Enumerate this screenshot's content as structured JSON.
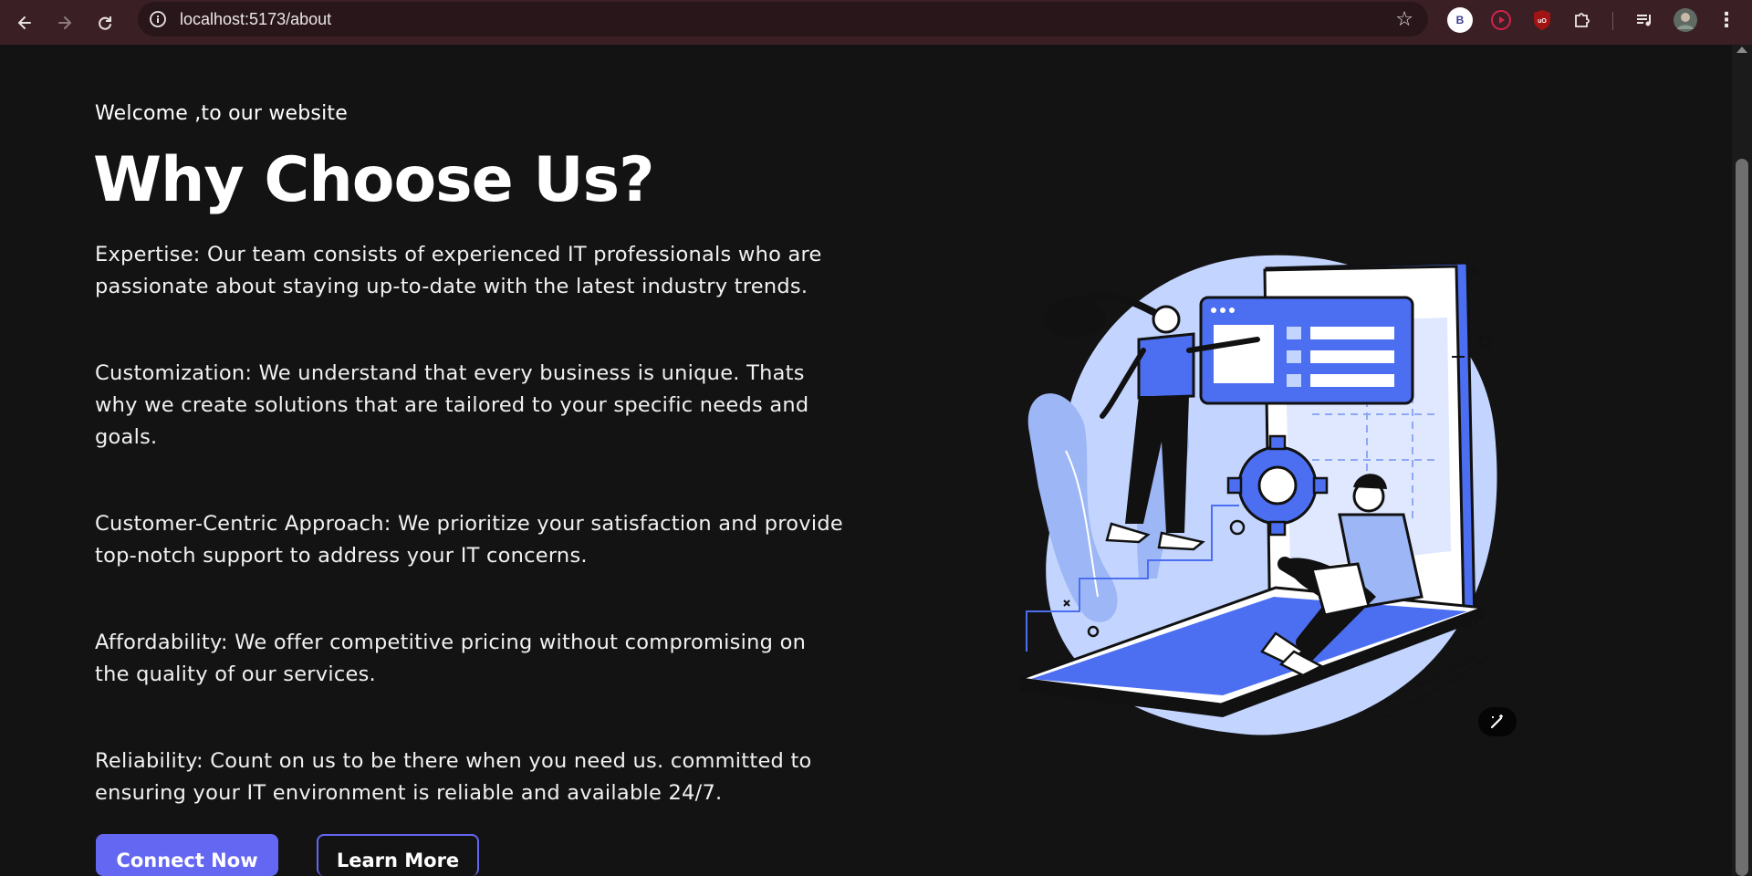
{
  "browser": {
    "url": "localhost:5173/about",
    "back_icon": "arrow-left-icon",
    "forward_icon": "arrow-right-icon",
    "reload_icon": "reload-icon",
    "bookmark_icon": "star-icon",
    "profile_ext_letter": "B",
    "menu_icon": "kebab-menu-icon"
  },
  "hero": {
    "welcome": "Welcome ,to our website",
    "title": "Why Choose Us?",
    "features": [
      "Expertise: Our team consists of experienced IT professionals who are passionate about staying up-to-date with the latest industry trends.",
      "Customization: We understand that every business is unique. Thats why we create solutions that are tailored to your specific needs and goals.",
      "Customer-Centric Approach: We prioritize your satisfaction and provide top-notch support to address your IT concerns.",
      "Affordability: We offer competitive pricing without compromising on the quality of our services.",
      "Reliability: Count on us to be there when you need us. committed to ensuring your IT environment is reliable and available 24/7."
    ],
    "primary_button": "Connect Now",
    "secondary_button": "Learn More"
  },
  "colors": {
    "accent": "#6467f2",
    "illustration_blue": "#4c6ef0",
    "illustration_light": "#c3d5ff",
    "background": "#131314"
  }
}
